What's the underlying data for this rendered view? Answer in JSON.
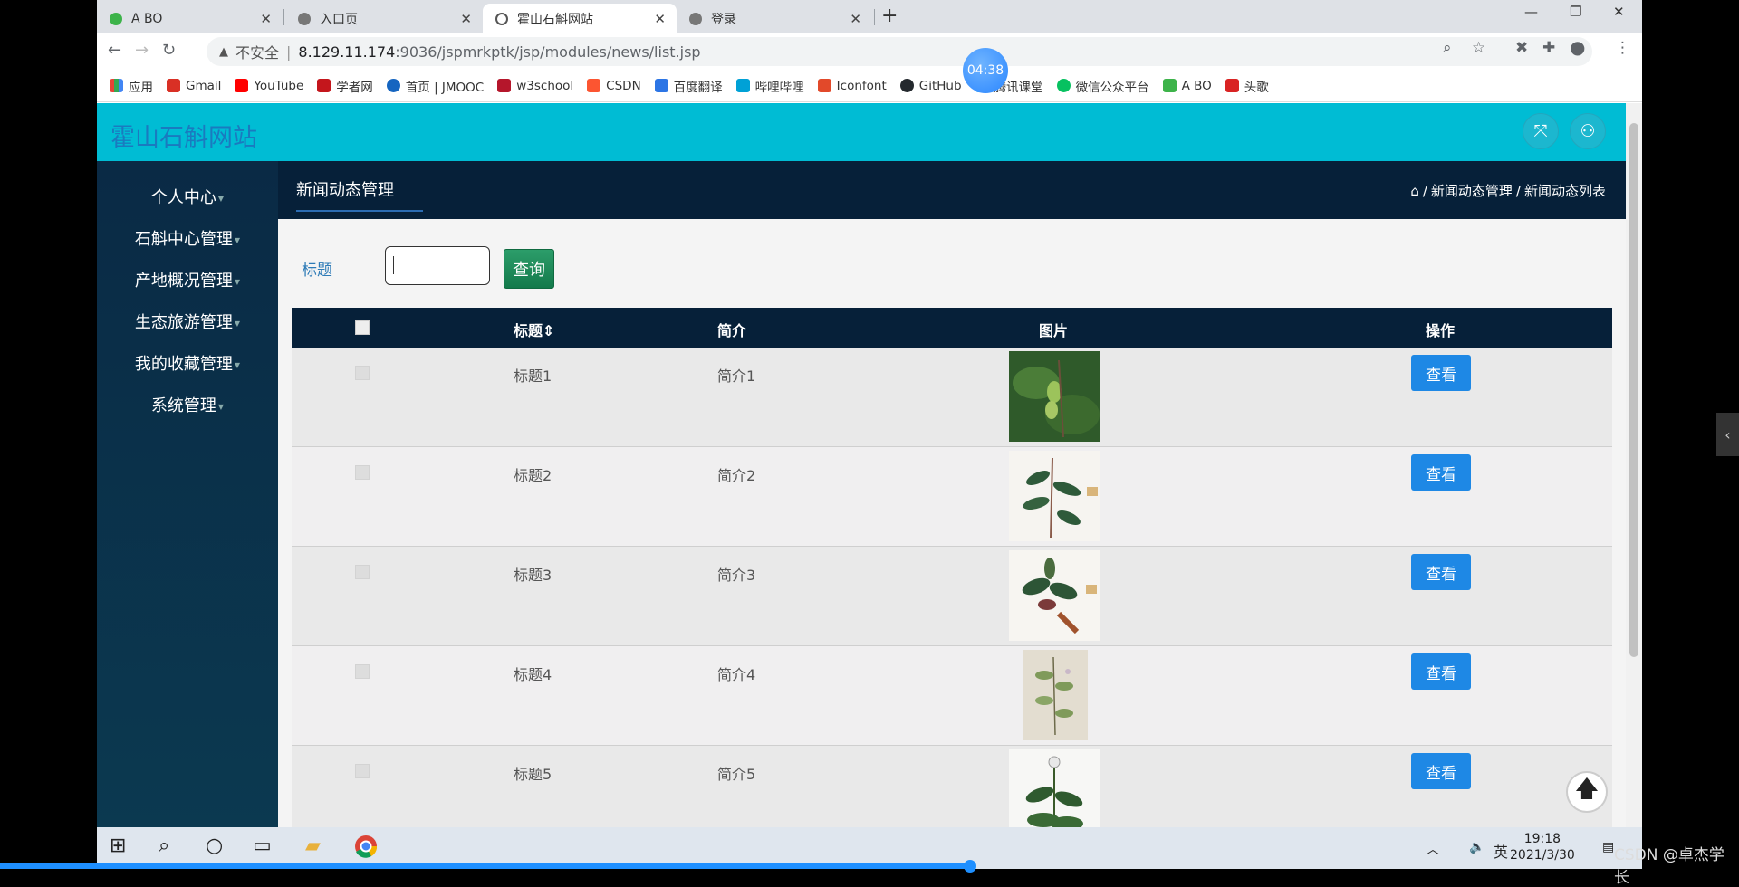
{
  "browser": {
    "tabs": [
      {
        "title": "A BO",
        "active": false,
        "favicon_color": "#3db34a"
      },
      {
        "title": "入口页",
        "active": false,
        "favicon_color": "#777"
      },
      {
        "title": "霍山石斛网站",
        "active": true,
        "favicon_color": "#555"
      },
      {
        "title": "登录",
        "active": false,
        "favicon_color": "#777"
      }
    ],
    "url": {
      "insecure_label": "不安全",
      "host": "8.129.11.174",
      "path": ":9036/jspmrkptk/jsp/modules/news/list.jsp"
    },
    "bookmarks": [
      {
        "label": "应用",
        "color": "#e84235"
      },
      {
        "label": "Gmail",
        "color": "#d93025"
      },
      {
        "label": "YouTube",
        "color": "#ff0000"
      },
      {
        "label": "学者网",
        "color": "#c4161c"
      },
      {
        "label": "首页 | JMOOC",
        "color": "#1565c0"
      },
      {
        "label": "w3school",
        "color": "#b5162b"
      },
      {
        "label": "CSDN",
        "color": "#fc5531"
      },
      {
        "label": "百度翻译",
        "color": "#2c75e5"
      },
      {
        "label": "哔哩哔哩",
        "color": "#00a1d6"
      },
      {
        "label": "Iconfont",
        "color": "#e2492a"
      },
      {
        "label": "GitHub",
        "color": "#24292e"
      },
      {
        "label": "腾讯课堂",
        "color": "#1a9bfc"
      },
      {
        "label": "微信公众平台",
        "color": "#07c160"
      },
      {
        "label": "A BO",
        "color": "#3db34a"
      },
      {
        "label": "头歌",
        "color": "#d92323"
      }
    ],
    "timer": "04:38"
  },
  "site": {
    "title": "霍山石斛网站"
  },
  "sidebar": {
    "items": [
      {
        "label": "个人中心"
      },
      {
        "label": "石斛中心管理"
      },
      {
        "label": "产地概况管理"
      },
      {
        "label": "生态旅游管理"
      },
      {
        "label": "我的收藏管理"
      },
      {
        "label": "系统管理"
      }
    ]
  },
  "header": {
    "tab": "新闻动态管理",
    "breadcrumb": [
      "新闻动态管理",
      "新闻动态列表"
    ],
    "breadcrumb_sep": "/"
  },
  "search": {
    "label": "标题",
    "value": "",
    "button": "查询"
  },
  "table": {
    "columns": [
      "标题",
      "简介",
      "图片",
      "操作"
    ],
    "sort_icon": "⇕",
    "action_label": "查看",
    "rows": [
      {
        "title": "标题1",
        "intro": "简介1"
      },
      {
        "title": "标题2",
        "intro": "简介2"
      },
      {
        "title": "标题3",
        "intro": "简介3"
      },
      {
        "title": "标题4",
        "intro": "简介4"
      },
      {
        "title": "标题5",
        "intro": "简介5"
      }
    ]
  },
  "taskbar": {
    "input_lang": "英",
    "time": "19:18",
    "date": "2021/3/30"
  },
  "watermark": "CSDN @卓杰学长",
  "colors": {
    "topbar": "#00bcd4",
    "sidebar": "#0a2a45",
    "header": "#062039",
    "primary_button": "#1e88e5",
    "search_button": "#1a8a57"
  }
}
